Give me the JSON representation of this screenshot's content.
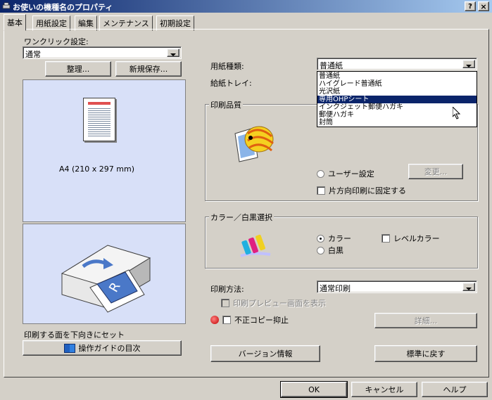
{
  "window": {
    "title": "お使いの機種名のプロパティ",
    "help_btn": "?",
    "close_btn": "×"
  },
  "tabs": [
    "基本",
    "用紙設定",
    "編集",
    "メンテナンス",
    "初期設定"
  ],
  "left": {
    "oneclick_label": "ワンクリック設定:",
    "oneclick_value": "通常",
    "organize_btn": "整理...",
    "save_new_btn": "新規保存...",
    "paper_size_text": "A4 (210 x 297 mm)",
    "feed_text": "印刷する面を下向きにセット",
    "guide_btn": "操作ガイドの目次"
  },
  "right": {
    "paper_type_label": "用紙種類:",
    "paper_type_value": "普通紙",
    "paper_type_options": [
      "普通紙",
      "ハイグレード普通紙",
      "光沢紙",
      "専用OHPシート",
      "インクジェット郵便ハガキ",
      "郵便ハガキ",
      "封筒"
    ],
    "paper_type_selected_index": 3,
    "tray_label": "給紙トレイ:",
    "quality_group": "印刷品質",
    "user_setting": "ユーザー設定",
    "change_btn": "変更...",
    "one_way_print": "片方向印刷に固定する",
    "color_group": "カラー／白黒選択",
    "color_opt": "カラー",
    "mono_opt": "白黒",
    "level_color": "レベルカラー",
    "print_method_label": "印刷方法:",
    "print_method_value": "通常印刷",
    "preview_label": "印刷プレビュー画面を表示",
    "prevent_copy": "不正コピー抑止",
    "detail_btn": "詳細...",
    "version_btn": "バージョン情報",
    "restore_btn": "標準に戻す"
  },
  "footer": {
    "ok": "OK",
    "cancel": "キャンセル",
    "help": "ヘルプ"
  },
  "colors": {
    "titlebar_start": "#0a246a",
    "titlebar_end": "#a6caf0",
    "preview_bg": "#d8e0f8"
  }
}
